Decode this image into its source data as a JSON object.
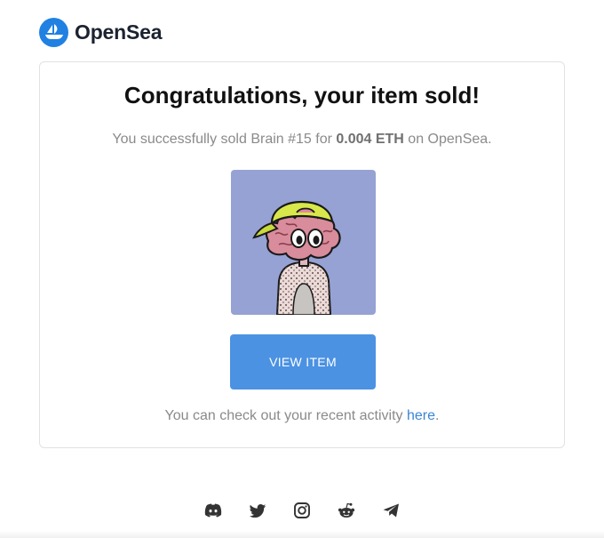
{
  "header": {
    "brand": "OpenSea"
  },
  "card": {
    "title": "Congratulations, your item sold!",
    "message_prefix": "You successfully sold Brain #15 for ",
    "price": "0.004 ETH",
    "message_suffix": " on OpenSea.",
    "button_label": "VIEW ITEM",
    "activity_prefix": "You can check out your recent activity ",
    "activity_link": "here",
    "activity_suffix": "."
  },
  "footer": {
    "icons": [
      "discord-icon",
      "twitter-icon",
      "instagram-icon",
      "reddit-icon",
      "telegram-icon"
    ]
  },
  "colors": {
    "brand_blue": "#2081e2",
    "button_blue": "#4b92e3",
    "link_blue": "#3a86d4",
    "nft_background": "#95a2d3"
  }
}
